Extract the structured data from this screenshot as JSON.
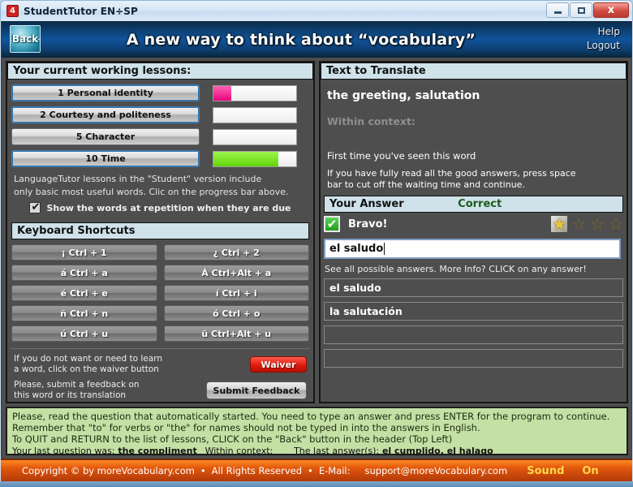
{
  "window": {
    "title": "StudentTutor EN÷SP",
    "app_icon": "app-icon",
    "minimize": "–",
    "maximize": "□",
    "close": "x"
  },
  "header": {
    "back_label": "Back",
    "heading": "A new way to think about “vocabulary”",
    "help": "Help",
    "logout": "Logout"
  },
  "left": {
    "lessons_title": "Your current working lessons:",
    "lessons": [
      {
        "label": "1 Personal identity",
        "progress": 22,
        "color": "#e8077f",
        "selected": true
      },
      {
        "label": "2 Courtesy and politeness",
        "progress": 0,
        "color": "",
        "selected": true
      },
      {
        "label": "5 Character",
        "progress": 0,
        "color": "",
        "selected": false
      },
      {
        "label": "10 Time",
        "progress": 78,
        "color": "#62d407",
        "selected": true
      }
    ],
    "note_line1": "LanguageTutor lessons in the \"Student\" version include",
    "note_line2": "only basic most useful words. Clic on the progress bar above.",
    "checkbox_label": "Show the words at repetition when they are due",
    "checkbox_checked": true,
    "shortcuts_title": "Keyboard Shortcuts",
    "shortcuts": [
      "¡ Ctrl + 1",
      "¿ Ctrl + 2",
      "á Ctrl + a",
      "Á Ctrl+Alt + a",
      "é Ctrl + e",
      "í Ctrl + i",
      "ñ Ctrl + n",
      "ó Ctrl + o",
      "ú Ctrl + u",
      "ü Ctrl+Alt + u"
    ],
    "waiver_text_line1": "If you do not want or need to learn",
    "waiver_text_line2": "a word, click on the waiver button",
    "waiver_button": "Waiver",
    "feedback_text_line1": "Please, submit a feedback on",
    "feedback_text_line2": "this word or its translation",
    "feedback_button": "Submit Feedback"
  },
  "right": {
    "translate_title": "Text to Translate",
    "word": "the greeting, salutation",
    "context_label": "Within context:",
    "context_value": "",
    "first_time": "First time you've seen this word",
    "press_space_line1": "If you have fully read all the good answers, press space",
    "press_space_line2": "bar to cut off the waiting time and continue.",
    "answer_title": "Your Answer",
    "answer_status": "Correct",
    "bravo": "Bravo!",
    "stars_total": 4,
    "stars_filled": 1,
    "answer_value": "el saludo",
    "see_all": "See all possible answers. More Info? CLICK on any answer!",
    "possible_answers": [
      "el saludo",
      "la salutación",
      "",
      ""
    ]
  },
  "help": {
    "line1": "Please, read the question that automatically started. You need to type an answer and press ENTER for the program to continue.",
    "line2": "Remember that \"to\" for verbs or \"the\" for names should not be typed in into the answers in English.",
    "line3": "To QUIT and RETURN to the list of lessons, CLICK on the \"Back\" button in the header (Top Left)",
    "last_question_label": "Your last question was:",
    "last_question_value": "the compliment",
    "last_context_label": "Within context:",
    "last_answer_label": "The last answer(s):",
    "last_answer_value": "el cumplido, el halaqo"
  },
  "footer": {
    "copyright": "Copyright © by moreVocabulary.com",
    "sep1": "•",
    "rights": "All Rights Reserved",
    "sep2": "•",
    "email_label": "E-Mail:",
    "email": "support@moreVocabulary.com",
    "sound_label": "Sound",
    "sound_state": "On"
  },
  "colors": {
    "accent_blue": "#10549b",
    "section_bar": "#cfe2ea",
    "correct_green": "#1a5c1a",
    "footer_orange": "#e0560c",
    "help_green": "#c4e0a4"
  }
}
